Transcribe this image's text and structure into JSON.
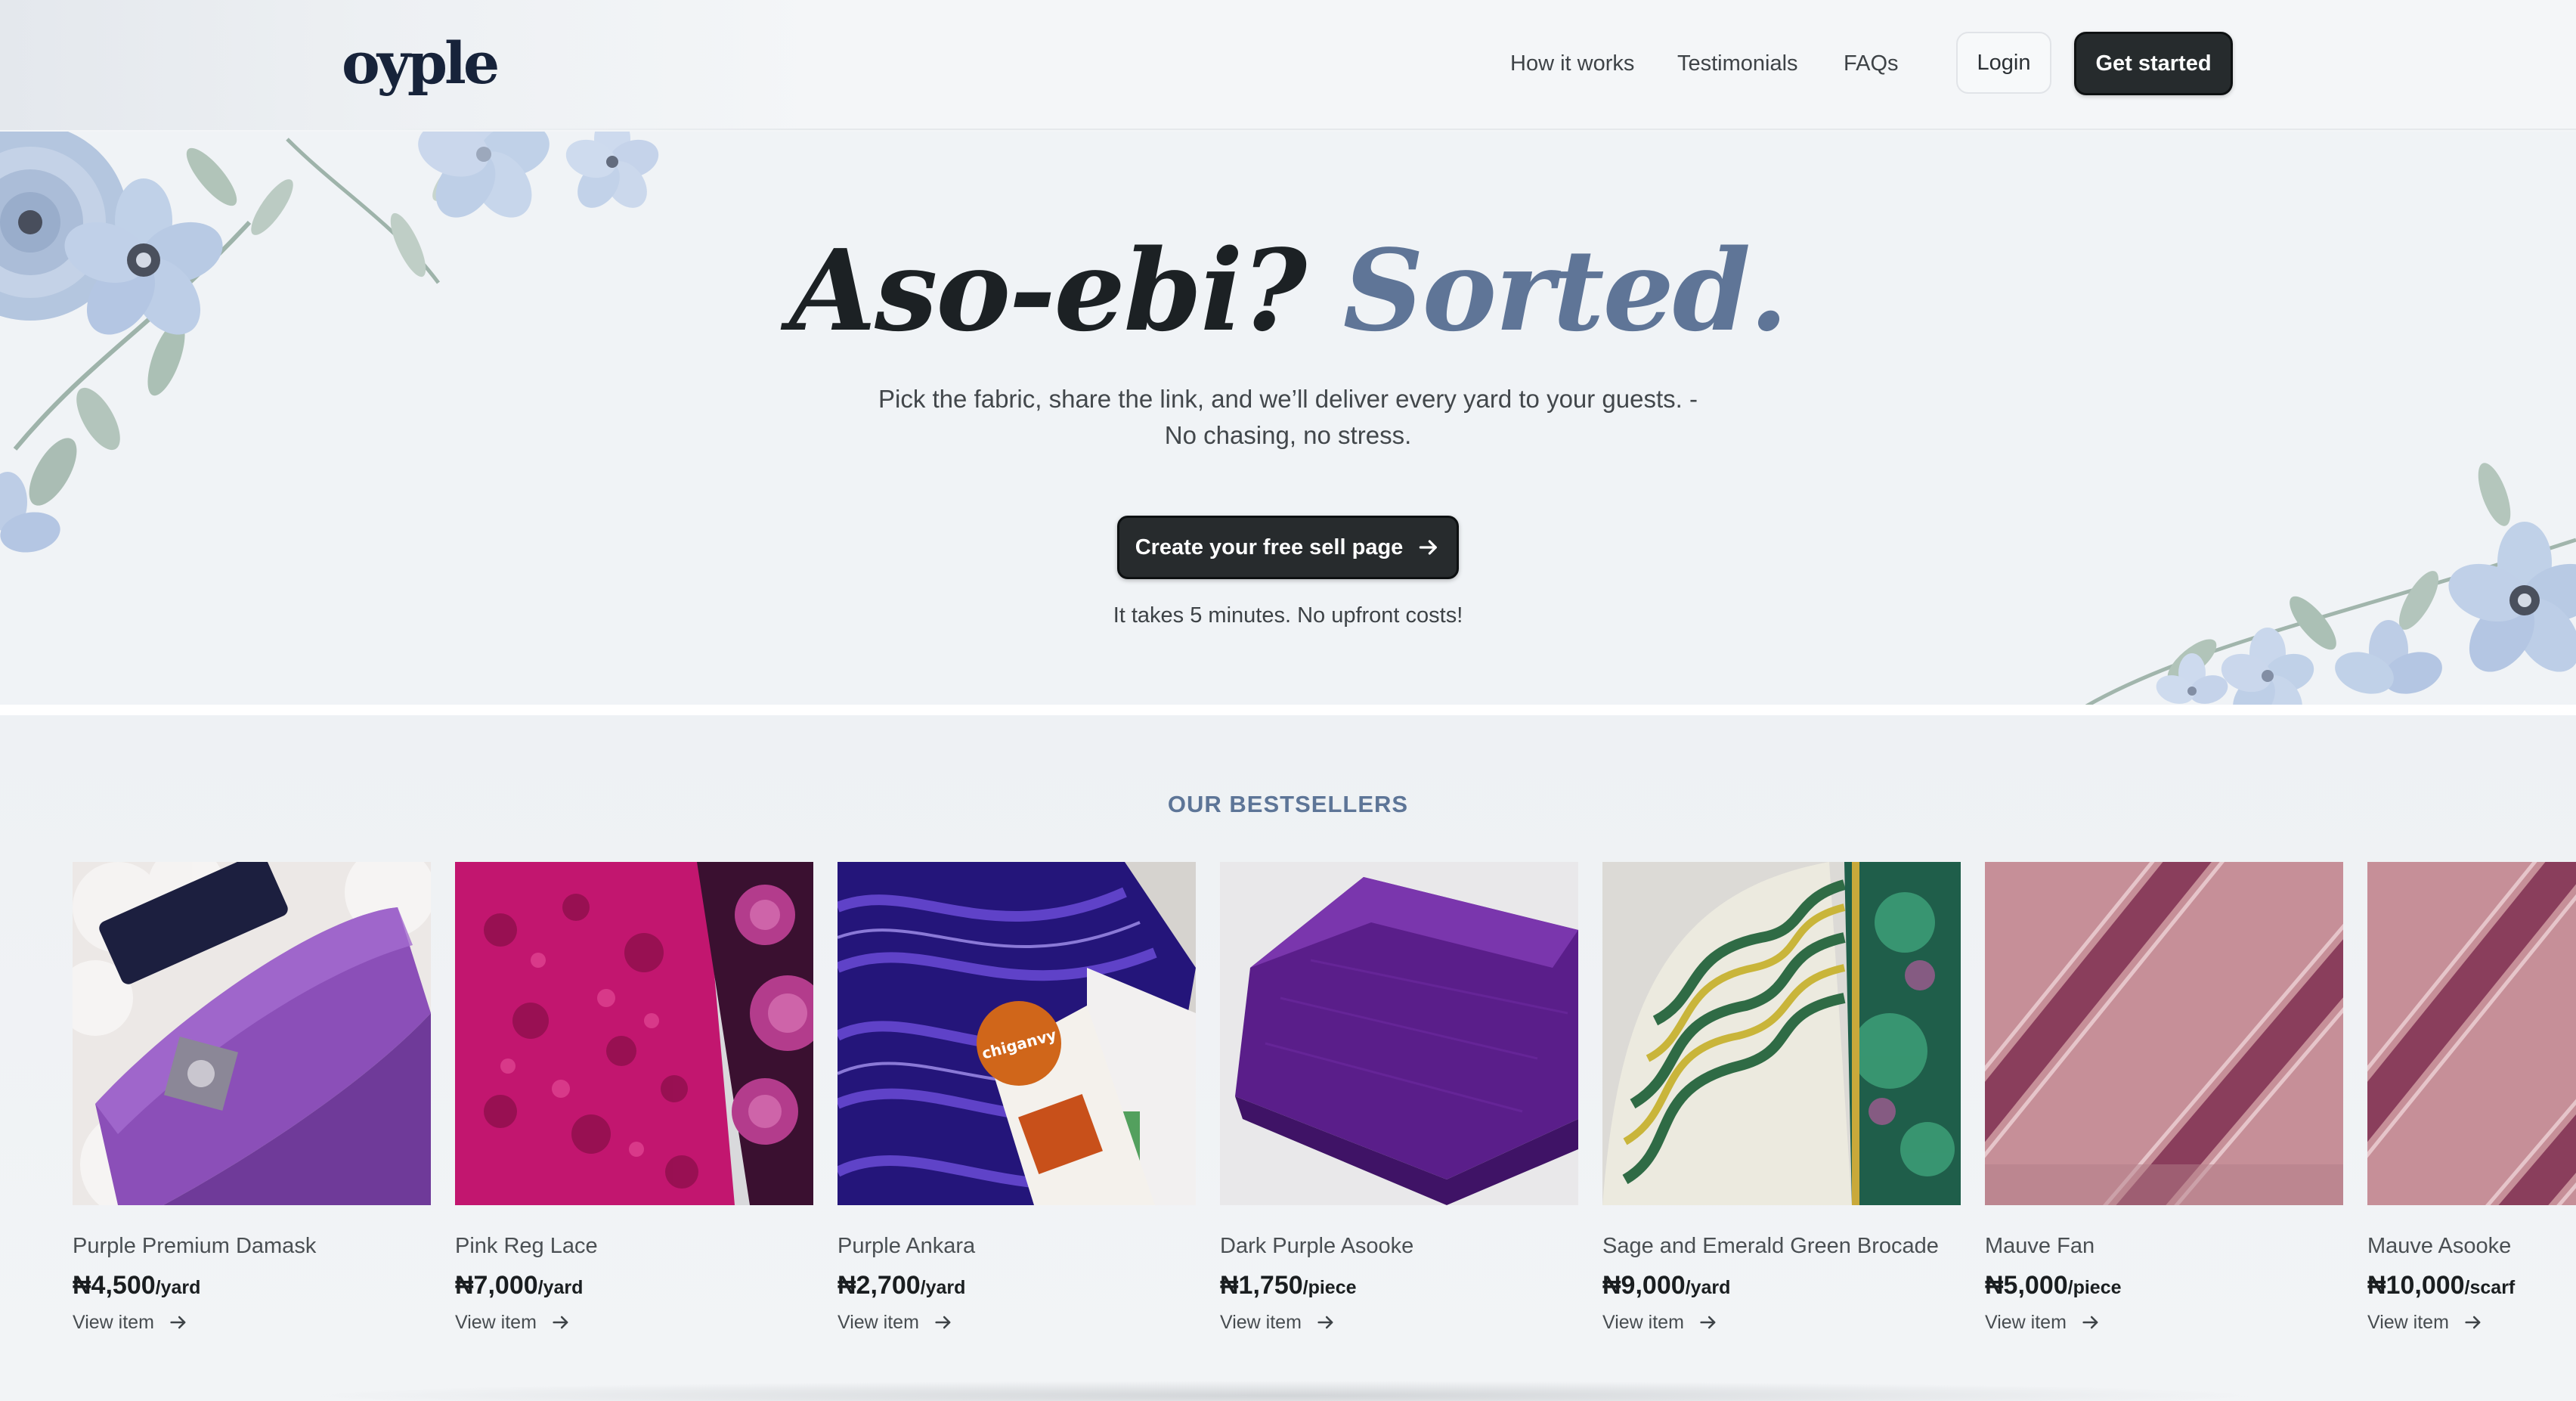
{
  "brand": {
    "logo_text": "oyple"
  },
  "nav": {
    "links": [
      "How it works",
      "Testimonials",
      "FAQs"
    ],
    "login": "Login",
    "get_started": "Get started"
  },
  "hero": {
    "title_part1": "Aso-ebi?",
    "title_part2": "Sorted.",
    "subtitle_line1": "Pick the fabric, share the link, and we’ll deliver every yard to your guests. -",
    "subtitle_line2": "No chasing, no stress.",
    "cta": "Create your free sell page",
    "note": "It takes 5 minutes. No upfront costs!"
  },
  "bestsellers": {
    "heading": "OUR BESTSELLERS",
    "view_label": "View item",
    "items": [
      {
        "name": "Purple Premium Damask",
        "price": "₦4,500",
        "unit": "/yard"
      },
      {
        "name": "Pink Reg Lace",
        "price": "₦7,000",
        "unit": "/yard"
      },
      {
        "name": "Purple Ankara",
        "price": "₦2,700",
        "unit": "/yard"
      },
      {
        "name": "Dark Purple Asooke",
        "price": "₦1,750",
        "unit": "/piece"
      },
      {
        "name": "Sage and Emerald Green Brocade",
        "price": "₦9,000",
        "unit": "/yard"
      },
      {
        "name": "Mauve Fan",
        "price": "₦5,000",
        "unit": "/piece"
      },
      {
        "name": "Mauve Asooke",
        "price": "₦10,000",
        "unit": "/scarf"
      }
    ]
  },
  "image_text": {
    "ankara_tag": "chiganvy"
  },
  "colors": {
    "accent": "#5f7597",
    "button_dark": "#272b2d",
    "background": "#f0f3f6"
  }
}
